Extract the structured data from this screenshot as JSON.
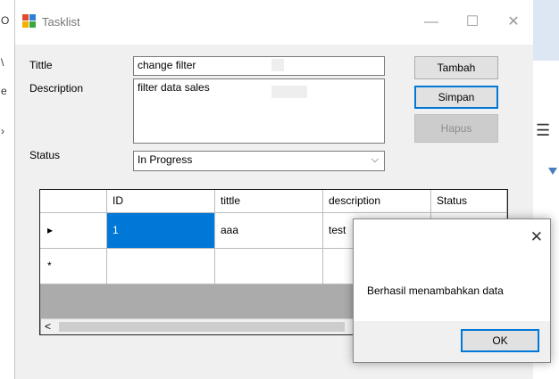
{
  "window": {
    "title": "Tasklist",
    "minimize_glyph": "—",
    "maximize_glyph": "☐",
    "close_glyph": "✕"
  },
  "form": {
    "tittle_label": "Tittle",
    "description_label": "Description",
    "status_label": "Status",
    "tittle_value": "change filter",
    "description_value": "filter data sales",
    "status_value": "In Progress"
  },
  "buttons": {
    "tambah": "Tambah",
    "simpan": "Simpan",
    "hapus": "Hapus"
  },
  "grid": {
    "columns": [
      "ID",
      "tittle",
      "description",
      "Status"
    ],
    "rows": [
      {
        "indicator": "▸",
        "id": "1",
        "tittle": "aaa",
        "description": "test",
        "status": ""
      },
      {
        "indicator": "*",
        "id": "",
        "tittle": "",
        "description": "",
        "status": ""
      }
    ],
    "scroll_left_glyph": "<"
  },
  "dialog": {
    "message": "Berhasil menambahkan data",
    "ok_label": "OK",
    "close_glyph": "✕"
  },
  "colors": {
    "selection": "#0078d7",
    "window_bg": "#f0f0f0"
  }
}
